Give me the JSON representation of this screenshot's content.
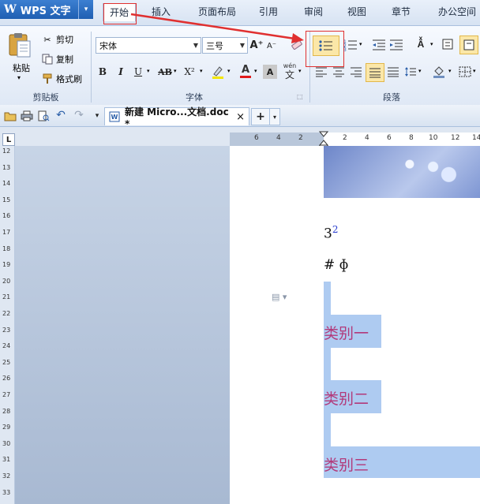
{
  "app": {
    "logo": "W",
    "title": "WPS 文字",
    "menu_arrow": "▾"
  },
  "tabs": [
    {
      "label": "开始",
      "active": true
    },
    {
      "label": "插入"
    },
    {
      "label": "页面布局"
    },
    {
      "label": "引用"
    },
    {
      "label": "审阅"
    },
    {
      "label": "视图"
    },
    {
      "label": "章节"
    },
    {
      "label": "办公空间"
    }
  ],
  "clipboard": {
    "paste": "粘贴",
    "cut": "剪切",
    "copy": "复制",
    "format_painter": "格式刷",
    "group_label": "剪贴板"
  },
  "font": {
    "name": "宋体",
    "size": "三号",
    "group_label": "字体",
    "bold": "B",
    "italic": "I",
    "underline": "U",
    "strike": "AB",
    "superscript": "X²",
    "grow": "A⁺",
    "shrink": "A⁻",
    "color_a": "A",
    "phonetic": "wén",
    "phonetic_char": "文"
  },
  "paragraph": {
    "group_label": "段落"
  },
  "document": {
    "tab_title": "新建 Micro...文档.doc *",
    "close": "×",
    "new_tab": "+"
  },
  "ruler": {
    "horizontal": [
      "6",
      "4",
      "2",
      "2",
      "4",
      "6",
      "8",
      "10",
      "12",
      "14"
    ],
    "vertical": [
      "12",
      "13",
      "14",
      "15",
      "16",
      "17",
      "18",
      "19",
      "20",
      "21",
      "22",
      "23",
      "24",
      "25",
      "26",
      "27",
      "28",
      "29",
      "30",
      "31",
      "32",
      "33"
    ]
  },
  "content": {
    "base": "3",
    "superscript": "2",
    "symbols": "# ɸ",
    "categories": [
      "类别一",
      "类别二",
      "类别三"
    ]
  },
  "colors": {
    "accent": "#2b6cc4",
    "highlight": "#aecbf1",
    "category_text": "#b2397a",
    "annotation": "#e03030"
  }
}
